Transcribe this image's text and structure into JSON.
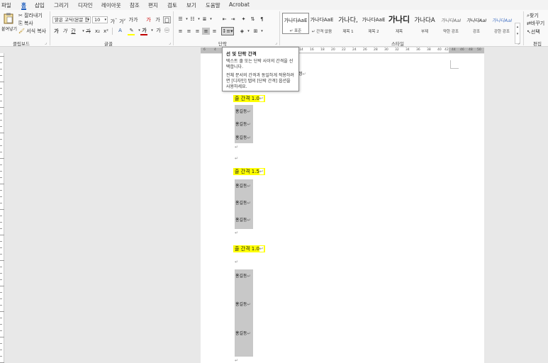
{
  "menu": {
    "tabs": [
      "파일",
      "홈",
      "삽입",
      "그리기",
      "디자인",
      "레이아웃",
      "참조",
      "편지",
      "검토",
      "보기",
      "도움말",
      "Acrobat"
    ],
    "active_tab": "홈"
  },
  "clipboard": {
    "paste_label": "붙여넣기",
    "cut_label": "잘라내기",
    "copy_label": "복사",
    "format_painter_label": "서식 복사",
    "group_label": "클립보드"
  },
  "font": {
    "font_name": "맑은 고딕(본문 한",
    "font_size": "10",
    "grow_label": "가",
    "shrink_label": "가",
    "case_label": "가가",
    "clear_label": "가",
    "phonetic_label": "가",
    "bold_label": "가",
    "italic_label": "가",
    "underline_label": "간",
    "strike_label": "가",
    "sub_label": "x₂",
    "super_label": "x²",
    "group_label": "글꼴",
    "font_color_label": "가",
    "circle_char_label": "가",
    "highlight_color": "#ffff00",
    "font_color": "#c00000"
  },
  "paragraph": {
    "group_label": "단락"
  },
  "styles": {
    "group_label": "스타일",
    "items": [
      {
        "sample": "가나다AaE",
        "name": "↵ 표준"
      },
      {
        "sample": "가나다AaE",
        "name": "↵ 간격 없음"
      },
      {
        "sample": "가나다,",
        "name": "제목 1"
      },
      {
        "sample": "가나다AaE",
        "name": "제목 2"
      },
      {
        "sample": "가나디",
        "name": "제목"
      },
      {
        "sample": "가나다A",
        "name": "부제"
      },
      {
        "sample": "가나다AaI",
        "name": "약한 강조"
      },
      {
        "sample": "가나다AaI",
        "name": "강조"
      },
      {
        "sample": "가나다AaI",
        "name": "강한 강조"
      }
    ]
  },
  "editing": {
    "find_label": "찾기",
    "replace_label": "바꾸기",
    "select_label": "선택",
    "group_label": "편집"
  },
  "ruler": {
    "ticks": [
      "6",
      "4",
      "2",
      "14",
      "16",
      "18",
      "20",
      "22",
      "24",
      "26",
      "28",
      "30",
      "32",
      "34",
      "36",
      "38",
      "40",
      "42",
      "44",
      "46",
      "48",
      "50"
    ]
  },
  "tooltip": {
    "title": "선 및 단락 간격",
    "body": "텍스트 줄 또는 단락 사이의 간격을 선택합니다.",
    "body2": "전체 문서의 간격과 동일하게 적용하려면 [디자인] 탭의 [단락 간격] 옵션을 사용하세요."
  },
  "document": {
    "top_text_tail": "정",
    "para_mark": "↵",
    "sections": [
      {
        "heading": "줄 간격 1.0",
        "lines": [
          "홍길동",
          "홍길동",
          "홍길동"
        ]
      },
      {
        "heading": "줄 간격 1.5",
        "lines": [
          "홍길동",
          "홍길동",
          "홍길동"
        ]
      },
      {
        "heading": "줄 간격 1.0",
        "lines": [
          "홍길동",
          "홍길동",
          "홍길동"
        ]
      }
    ]
  },
  "colors": {
    "accent": "#185abd",
    "highlight": "#ffff00",
    "gray_block": "#c8c8c8"
  }
}
